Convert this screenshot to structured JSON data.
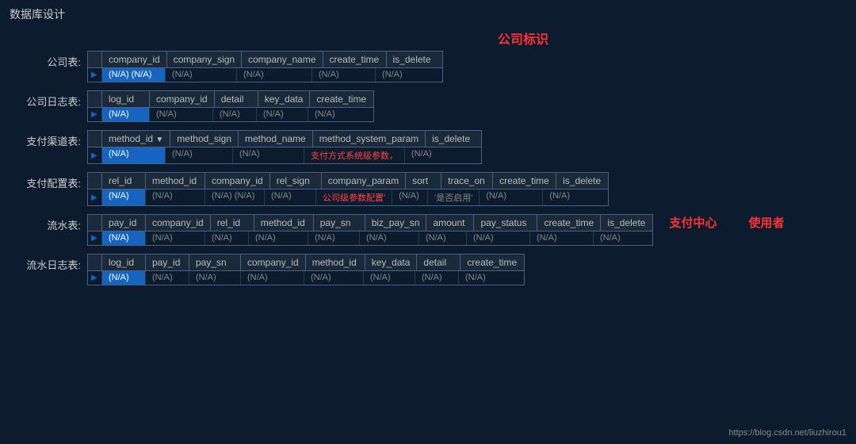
{
  "page": {
    "title": "数据库设计",
    "center_label": "公司标识",
    "footer_url": "https://blog.csdn.net/liuzhirou1"
  },
  "tables": [
    {
      "label": "公司表:",
      "columns": [
        "company_id",
        "company_sign",
        "company_name",
        "create_time",
        "is_delete"
      ],
      "widths": [
        80,
        90,
        95,
        80,
        70
      ],
      "values": [
        "(N/A) (N/A)",
        "(N/A)",
        "(N/A)",
        "(N/A)",
        "(N/A)"
      ],
      "highlight_col": 0,
      "has_arrow": true
    },
    {
      "label": "公司日志表:",
      "columns": [
        "log_id",
        "company_id",
        "detail",
        "key_data",
        "create_time"
      ],
      "widths": [
        60,
        80,
        55,
        65,
        80
      ],
      "values": [
        "(N/A)",
        "(N/A)",
        "(N/A)",
        "(N/A)",
        "(N/A)"
      ],
      "highlight_col": 0,
      "has_arrow": true
    },
    {
      "label": "支付渠道表:",
      "columns": [
        "method_id",
        "method_sign",
        "method_name",
        "method_system_param",
        "is_delete"
      ],
      "widths": [
        80,
        85,
        90,
        120,
        70
      ],
      "values": [
        "(N/A)",
        "(N/A)",
        "(N/A)",
        "支付方式系统级参数，",
        "(N/A)"
      ],
      "highlight_col": 0,
      "has_dropdown": true,
      "has_arrow": true,
      "red_col": 3
    },
    {
      "label": "支付配置表:",
      "columns": [
        "rel_id",
        "method_id",
        "company_id",
        "rel_sign",
        "company_param",
        "sort",
        "trace_on",
        "create_time",
        "is_delete"
      ],
      "widths": [
        55,
        75,
        75,
        65,
        95,
        45,
        65,
        80,
        65
      ],
      "values": [
        "(N/A)",
        "(N/A)",
        "(N/A) (N/A)",
        "(N/A)",
        "公司级参数配置'",
        "(N/A)",
        "'是否启用'",
        "(N/A)",
        "(N/A)"
      ],
      "highlight_col": 0,
      "has_arrow": true,
      "red_col": 4
    },
    {
      "label": "流水表:",
      "columns": [
        "pay_id",
        "company_id",
        "rel_id",
        "method_id",
        "pay_sn",
        "biz_pay_sn",
        "amount",
        "pay_status",
        "create_time",
        "is_delete"
      ],
      "widths": [
        55,
        75,
        55,
        75,
        65,
        75,
        60,
        80,
        80,
        65
      ],
      "values": [
        "(N/A)",
        "(N/A)",
        "(N/A)",
        "(N/A)",
        "(N/A)",
        "(N/A)",
        "(N/A)",
        "(N/A)",
        "(N/A)",
        "(N/A)"
      ],
      "highlight_col": 0,
      "has_arrow": true,
      "annotations": [
        "支付中心",
        "使用者"
      ]
    },
    {
      "label": "流水日志表:",
      "columns": [
        "log_id",
        "pay_id",
        "pay_sn",
        "company_id",
        "method_id",
        "key_data",
        "detail",
        "create_time"
      ],
      "widths": [
        55,
        55,
        65,
        80,
        75,
        65,
        55,
        80
      ],
      "values": [
        "(N/A)",
        "(N/A)",
        "(N/A)",
        "(N/A)",
        "(N/A)",
        "(N/A)",
        "(N/A)",
        "(N/A)"
      ],
      "highlight_col": 0,
      "has_arrow": true
    }
  ]
}
